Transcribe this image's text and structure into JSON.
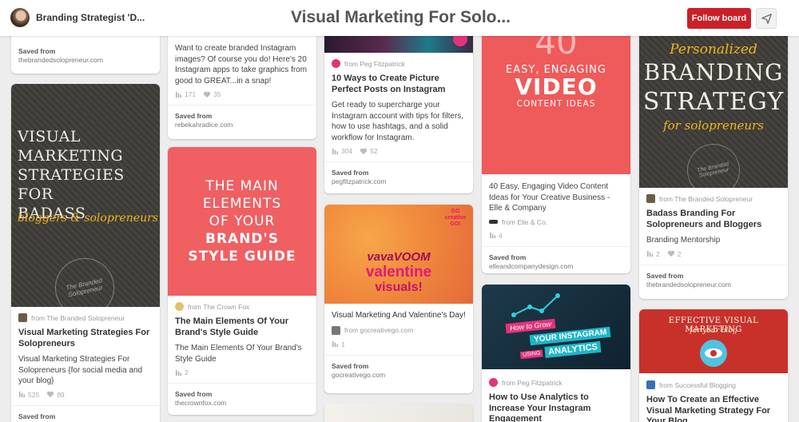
{
  "header": {
    "profile_name": "Branding Strategist 'D...",
    "board_title": "Visual Marketing For Solo...",
    "follow_label": "Follow board"
  },
  "labels": {
    "saved_from": "Saved from"
  },
  "col1": {
    "top": {
      "saved_domain": "thebrandedsolopreneur.com"
    },
    "pin2": {
      "image_lines": [
        "VISUAL MARKETING",
        "STRATEGIES",
        "FOR",
        "BADASS"
      ],
      "image_script": "bloggers & solopreneurs",
      "image_watermark": "The Branded Solopreneur",
      "from": "from The Branded Solopreneur",
      "title": "Visual Marketing Strategies For Solopreneurs",
      "desc": "Visual Marketing Strategies For Solopreneurs {for social media and your blog}",
      "repins": "525",
      "likes": "89"
    }
  },
  "col2": {
    "top": {
      "desc": "Want to create branded Instagram images? Of course you do! Here's 20 Instagram apps to take graphics from good to GREAT...in a snap!",
      "repins": "171",
      "likes": "35",
      "saved_domain": "rebekahradice.com"
    },
    "pin2": {
      "image_lines": [
        "THE MAIN",
        "ELEMENTS",
        "OF YOUR"
      ],
      "image_bold": [
        "BRAND'S",
        "STYLE GUIDE"
      ],
      "from": "from The Crown Fox",
      "title": "The Main Elements Of Your Brand's Style Guide",
      "desc": "The Main Elements Of Your Brand's Style Guide",
      "repins": "2",
      "saved_domain": "thecrownfox.com"
    }
  },
  "col3": {
    "top": {
      "from": "from Peg Fitzpatrick",
      "title": "10 Ways to Create Picture Perfect Posts on Instagram",
      "desc": "Get ready to supercharge your Instagram account with tips for filters, how to use hashtags, and a solid workflow for Instagram.",
      "repins": "304",
      "likes": "52",
      "saved_domain": "pegfitzpatrick.com"
    },
    "pin2": {
      "image_big1": "vavaVOOM",
      "image_big2": "valentine",
      "image_big3": "visuals!",
      "image_badge": "GO creative GO!",
      "title": "Visual Marketing And Valentine's Day!",
      "from": "from gocreativego.com",
      "repins": "1",
      "saved_domain": "gocreativego.com"
    }
  },
  "col4": {
    "top": {
      "image_num": "40",
      "image_l1": "EASY, ENGAGING",
      "image_l2": "VIDEO",
      "image_l3": "CONTENT IDEAS",
      "desc": "40 Easy, Engaging Video Content Ideas for Your Creative Business - Elle & Company",
      "from": "from Elle & Co.",
      "repins": "4",
      "saved_domain": "elleandcompanydesign.com"
    },
    "pin2": {
      "image_l1": "How to Grow",
      "image_l2": "YOUR INSTAGRAM",
      "image_l3a": "USING",
      "image_l3b": "ANALYTICS",
      "from": "from Peg Fitzpatrick",
      "title": "How to Use Analytics to Increase Your Instagram Engagement"
    }
  },
  "col5": {
    "top": {
      "image_l1": "Personalized",
      "image_l2": "BRANDING",
      "image_l3": "STRATEGY",
      "image_l4": "for solopreneurs",
      "image_watermark": "The Branded Solopreneur",
      "from": "from The Branded Solopreneur",
      "title": "Badass Branding For Solopreneurs and Bloggers",
      "desc": "Branding Mentorship",
      "repins": "2",
      "likes": "2",
      "saved_domain": "thebrandedsolopreneur.com"
    },
    "pin2": {
      "image_l1": "EFFECTIVE VISUAL MARKETING",
      "image_l2": "for your blog",
      "from": "from Successful Blogging",
      "title": "How To Create an Effective Visual Marketing Strategy For Your Blog"
    }
  },
  "colors": {
    "follow": "#cb2027",
    "pink": "#f05f62",
    "coral": "#ef5a5a",
    "chalk": "#3e3c37",
    "teal": "#1fb6c8"
  }
}
